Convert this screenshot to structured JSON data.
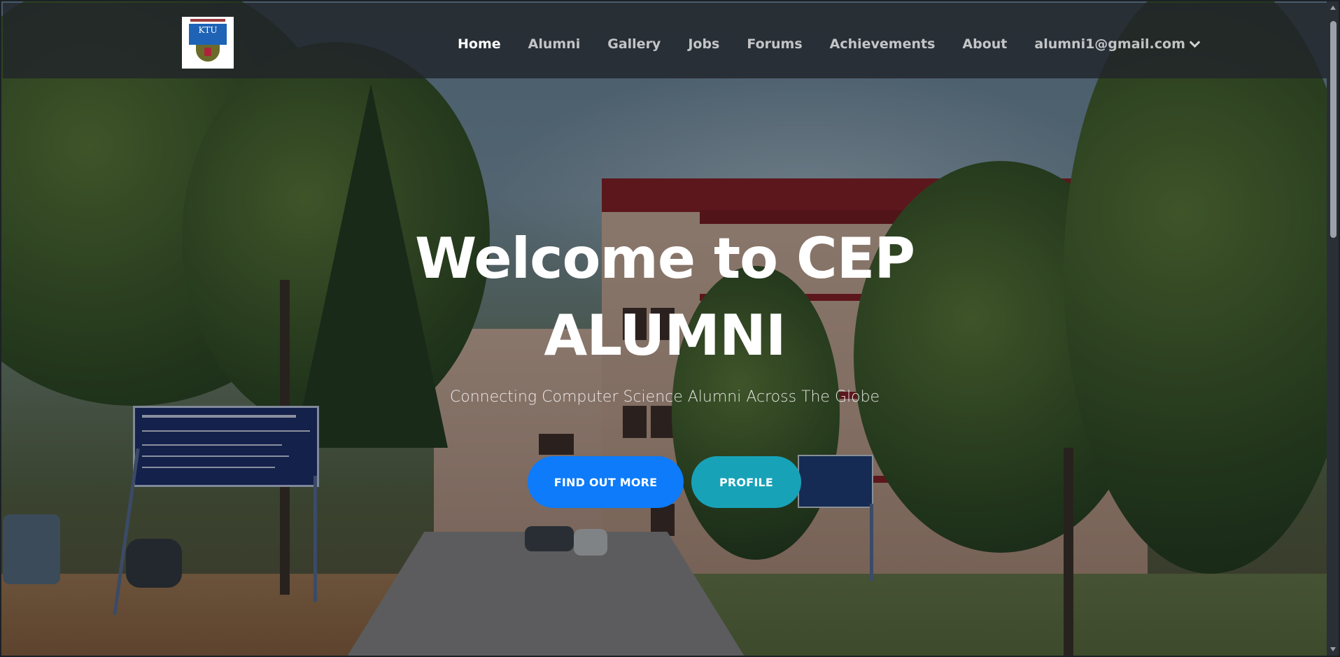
{
  "nav": {
    "logo_alt": "KTU",
    "links": [
      {
        "label": "Home",
        "active": true
      },
      {
        "label": "Alumni",
        "active": false
      },
      {
        "label": "Gallery",
        "active": false
      },
      {
        "label": "Jobs",
        "active": false
      },
      {
        "label": "Forums",
        "active": false
      },
      {
        "label": "Achievements",
        "active": false
      },
      {
        "label": "About",
        "active": false
      }
    ],
    "user_email": "alumni1@gmail.com",
    "user_menu_icon": "chevron-down-icon"
  },
  "hero": {
    "title_line1": "Welcome to CEP",
    "title_line2": "ALUMNI",
    "subtitle": "Connecting Computer Science Alumni Across The Globe",
    "primary_button": "FIND OUT MORE",
    "secondary_button": "PROFILE",
    "background": "campus-photo"
  },
  "colors": {
    "navbar_bg": "#212529",
    "primary": "#0d7bfa",
    "info": "#17a2b8",
    "text": "#ffffff"
  }
}
